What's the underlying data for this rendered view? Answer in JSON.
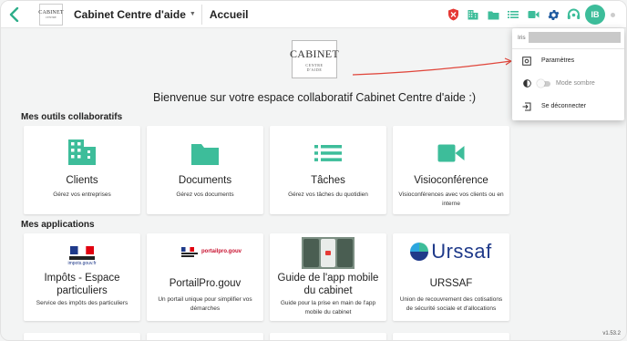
{
  "header": {
    "logo_text": "CABINET",
    "company_name": "Cabinet Centre d'aide",
    "page_title": "Accueil",
    "user_initials": "IB"
  },
  "hero": {
    "logo_line1": "CABINET",
    "logo_line2": "CENTRE",
    "logo_line3": "D'AIDE",
    "welcome": "Bienvenue sur votre espace collaboratif Cabinet Centre d'aide :)"
  },
  "tools_section": {
    "title": "Mes outils collaboratifs",
    "cards": [
      {
        "title": "Clients",
        "desc": "Gérez vos entreprises",
        "icon": "building-icon"
      },
      {
        "title": "Documents",
        "desc": "Gérez vos documents",
        "icon": "folder-icon"
      },
      {
        "title": "Tâches",
        "desc": "Gérez vos tâches du quotidien",
        "icon": "list-icon"
      },
      {
        "title": "Visioconférence",
        "desc": "Visioconférences avec vos clients ou en interne",
        "icon": "video-icon"
      }
    ]
  },
  "apps_section": {
    "title": "Mes applications",
    "cards": [
      {
        "title": "Impôts - Espace particuliers",
        "desc": "Service des impôts des particuliers",
        "logo_text": "impots.gouv.fr"
      },
      {
        "title": "PortailPro.gouv",
        "desc": "Un portail unique pour simplifier vos démarches",
        "logo_text": "portailpro.gouv"
      },
      {
        "title": "Guide de l'app mobile du cabinet",
        "desc": "Guide pour la prise en main de l'app mobile du cabinet",
        "logo_text": ""
      },
      {
        "title": "URSSAF",
        "desc": "Union de recouvrement des cotisations de sécurité sociale et d'allocations",
        "logo_text": "Urssaf"
      }
    ]
  },
  "user_menu": {
    "user_label": "Iris",
    "items": [
      {
        "label": "Paramètres",
        "icon": "settings-box-icon"
      },
      {
        "label": "Mode sombre",
        "icon": "contrast-icon"
      },
      {
        "label": "Se déconnecter",
        "icon": "logout-icon"
      }
    ]
  },
  "footer": {
    "version": "v1.53.2"
  },
  "colors": {
    "accent": "#3dbd9a",
    "back_arrow": "#2fae8a",
    "shield": "#e53935",
    "annotation_arrow": "#e0463b"
  }
}
